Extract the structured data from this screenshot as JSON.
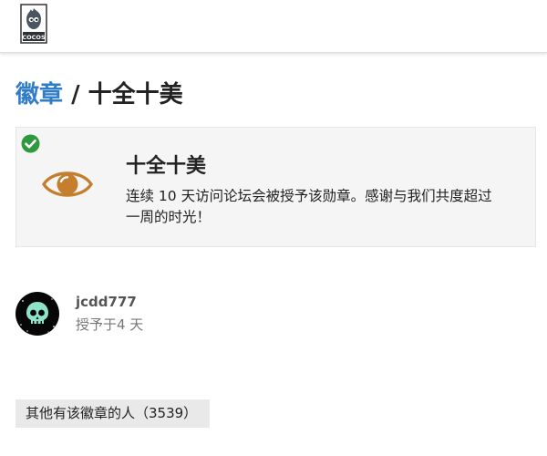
{
  "header": {
    "logo_text": "COCOS",
    "logo_icon": "cocos-logo"
  },
  "page": {
    "breadcrumb_link": "徽章",
    "separator": " / ",
    "badge_title": "十全十美"
  },
  "badge": {
    "name": "十全十美",
    "description": "连续 10 天访问论坛会被授予该勋章。感谢与我们共度超过一周的时光！",
    "icon": "eye-icon",
    "granted_icon": "check-circle-icon",
    "icon_color": "#c47e2e",
    "check_color": "#2e9a3d"
  },
  "grantee": {
    "username": "jcdd777",
    "granted_text": "授予于4 天",
    "avatar_icon": "skull-avatar"
  },
  "others": {
    "label": "其他有该徽章的人（3539）"
  },
  "colors": {
    "link": "#2f7dc6",
    "card_bg": "#f5f5f5",
    "button_bg": "#e9e9e9"
  }
}
